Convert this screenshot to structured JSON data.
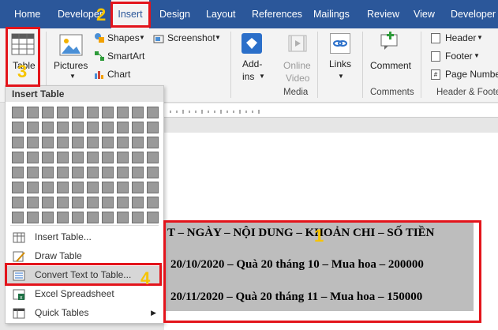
{
  "tabs": [
    {
      "label": "Home",
      "active": false
    },
    {
      "label": "Developer",
      "active": false
    },
    {
      "label": "Insert",
      "active": true
    },
    {
      "label": "Design",
      "active": false
    },
    {
      "label": "Layout",
      "active": false
    },
    {
      "label": "References",
      "active": false
    },
    {
      "label": "Mailings",
      "active": false
    },
    {
      "label": "Review",
      "active": false
    },
    {
      "label": "View",
      "active": false
    },
    {
      "label": "Developer",
      "active": false
    }
  ],
  "ribbon": {
    "table_label": "Table",
    "pictures_label": "Pictures",
    "shapes_label": "Shapes",
    "smartart_label": "SmartArt",
    "chart_label": "Chart",
    "screenshot_label": "Screenshot",
    "addins_label_1": "Add-",
    "addins_label_2": "ins",
    "online_video_1": "Online",
    "online_video_2": "Video",
    "links_label": "Links",
    "comment_label": "Comment",
    "header_label": "Header",
    "footer_label": "Footer",
    "page_number_label": "Page Numbe",
    "groups": {
      "media": "Media",
      "comments": "Comments",
      "header_footer": "Header & Foote"
    }
  },
  "dropdown": {
    "title": "Insert Table",
    "items": [
      {
        "label": "Insert Table...",
        "icon": "insert-table-icon"
      },
      {
        "label": "Draw Table",
        "icon": "draw-table-icon"
      },
      {
        "label": "Convert Text to Table...",
        "icon": "convert-text-icon",
        "highlighted": true
      },
      {
        "label": "Excel Spreadsheet",
        "icon": "excel-icon"
      },
      {
        "label": "Quick Tables",
        "icon": "quick-tables-icon",
        "submenu": true
      }
    ]
  },
  "document": {
    "lines": [
      "T – NGÀY – NỘI DUNG – KHOẢN CHI – SỐ TIỀN",
      "20/10/2020 – Quà 20 tháng 10 – Mua hoa – 200000",
      "20/11/2020 – Quà 20 tháng 11 – Mua hoa – 150000"
    ]
  },
  "annotations": {
    "step1": "1",
    "step2": "2",
    "step3": "3",
    "step4": "4",
    "highlight_color": "#e3141b",
    "number_color": "#f6c400"
  },
  "colors": {
    "ribbon_blue": "#2b579a",
    "ribbon_bg": "#f3f3f3"
  }
}
